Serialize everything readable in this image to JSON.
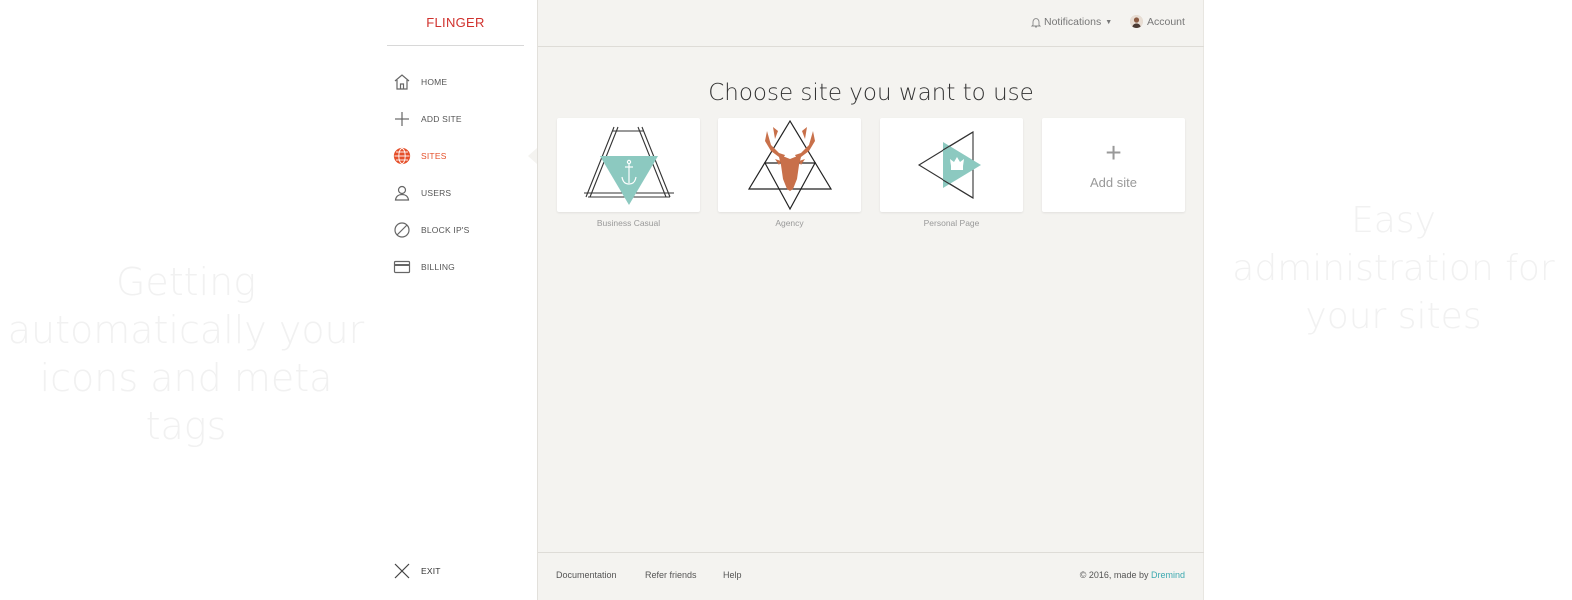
{
  "background_text": {
    "left": "Getting automatically your icons and meta tags",
    "right": "Easy administration for your sites"
  },
  "sidebar": {
    "brand": "FLINGER",
    "items": [
      {
        "label": "HOME",
        "icon": "home-icon"
      },
      {
        "label": "ADD SITE",
        "icon": "plus-icon"
      },
      {
        "label": "SITES",
        "icon": "globe-icon",
        "active": true
      },
      {
        "label": "USERS",
        "icon": "user-icon"
      },
      {
        "label": "BLOCK IP'S",
        "icon": "block-icon"
      },
      {
        "label": "BILLING",
        "icon": "credit-card-icon"
      }
    ],
    "exit_label": "EXIT"
  },
  "topbar": {
    "notifications_label": "Notifications",
    "account_label": "Account"
  },
  "main": {
    "heading": "Choose site you want to use",
    "sites": [
      {
        "name": "Business Casual",
        "logo": "anchor-triangle-logo"
      },
      {
        "name": "Agency",
        "logo": "deer-triangle-logo"
      },
      {
        "name": "Personal Page",
        "logo": "crown-triangle-logo"
      }
    ],
    "add_site_label": "Add site",
    "add_site_plus": "+"
  },
  "footer": {
    "links": [
      "Documentation",
      "Refer friends",
      "Help"
    ],
    "copyright_prefix": "© 2016, made by",
    "copyright_brand": "Dremind"
  },
  "colors": {
    "brand": "#d0312d",
    "active": "#e5502a",
    "teal": "#8cc9c0",
    "deer": "#c8704a",
    "link": "#3ca9b0",
    "main_bg": "#f4f3f0"
  }
}
